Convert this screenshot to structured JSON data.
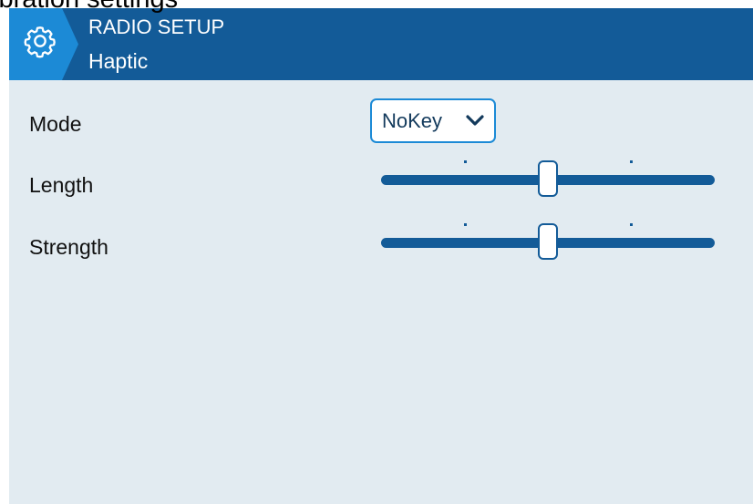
{
  "caption": "ibration settings",
  "header": {
    "title": "RADIO SETUP",
    "subtitle": "Haptic",
    "icon": "gear-icon"
  },
  "settings": {
    "mode": {
      "label": "Mode",
      "value": "NoKey"
    },
    "length": {
      "label": "Length",
      "level": 0.5
    },
    "strength": {
      "label": "Strength",
      "level": 0.5
    }
  },
  "colors": {
    "header_bg": "#135b98",
    "screen_bg": "#e2ebf1",
    "accent": "#1c8ad6",
    "text": "#111111"
  }
}
